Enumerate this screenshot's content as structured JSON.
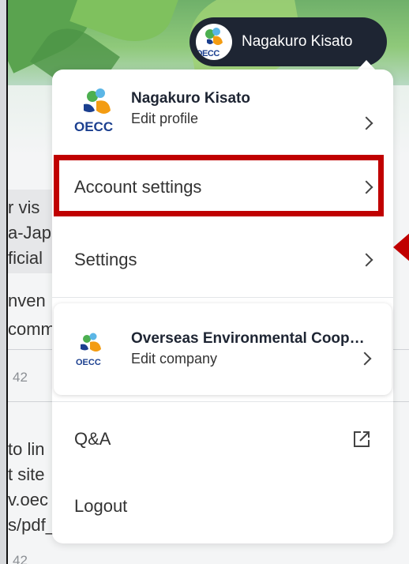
{
  "user": {
    "name": "Nagakuro Kisato"
  },
  "org_logo": {
    "text": "OECC"
  },
  "menu": {
    "profile": {
      "name": "Nagakuro Kisato",
      "action": "Edit profile"
    },
    "account_settings": "Account settings",
    "settings": "Settings",
    "company": {
      "name": "Overseas Environmental Cooperation Center",
      "action": "Edit company"
    },
    "qa": "Q&A",
    "logout": "Logout"
  },
  "background": {
    "snippets": [
      "r vis",
      "a-Jap",
      "ficial",
      "nven",
      "comm",
      "to lin",
      "t site",
      "v.oec",
      "s/pdf_"
    ],
    "meta": [
      "42",
      "42"
    ]
  },
  "colors": {
    "highlight": "#c00000",
    "pill": "#1e2533",
    "logo_blue": "#1b3f8f",
    "logo_green": "#4caf50",
    "logo_orange": "#f39c12",
    "logo_lightblue": "#5bb6e6"
  },
  "icons": [
    "chevron-right-icon",
    "external-link-icon",
    "oecc-logo"
  ]
}
